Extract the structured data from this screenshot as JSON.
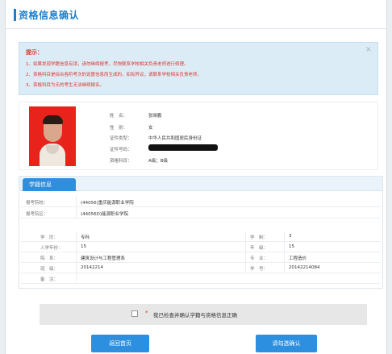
{
  "header": {
    "title": "资格信息确认"
  },
  "tips": {
    "title": "提示：",
    "close": "×",
    "lines": [
      "1、如果发现学籍信息有误，请勿继续报考，尽快联系学校相关负责老师进行修理。",
      "2、资格科目是综合各阶考次的设置信息而生成的，如有异议，请联系学校相关负责老师。",
      "3、资格科目为无的考生无法继续报名。"
    ]
  },
  "person": {
    "name_label": "姓　名：",
    "name": "张晓鹏",
    "gender_label": "性　别：",
    "gender": "女",
    "idtype_label": "证件类型：",
    "idtype": "中华人民共和国居民身份证",
    "idno_label": "证件号码：",
    "subject_label": "资格科目：",
    "subject": "A级；B级"
  },
  "education": {
    "tab": "学籍信息",
    "rows": [
      {
        "l1": "报考院校：",
        "v1": "(44056)重庆能源职业学院"
      },
      {
        "l1": "报考院区：",
        "v1": "(44056D)能源职业学院"
      },
      {
        "l1": "学　历：",
        "v1": "专科",
        "l2": "学　制：",
        "v2": "3"
      },
      {
        "l1": "入学年份：",
        "v1": "15",
        "l2": "年　级：",
        "v2": "15"
      },
      {
        "l1": "院　系：",
        "v1": "建筑设计与工程管理系",
        "l2": "专　业：",
        "v2": "工程造价"
      },
      {
        "l1": "班　级：",
        "v1": "20142214",
        "l2": "学　号：",
        "v2": "20142214084"
      },
      {
        "l1": "备　注：",
        "v1": ""
      }
    ]
  },
  "confirm": {
    "star": "*",
    "text": "我已检查并确认学籍与资格信息正确"
  },
  "buttons": {
    "back": "返回首页",
    "next": "请勾选确认"
  }
}
